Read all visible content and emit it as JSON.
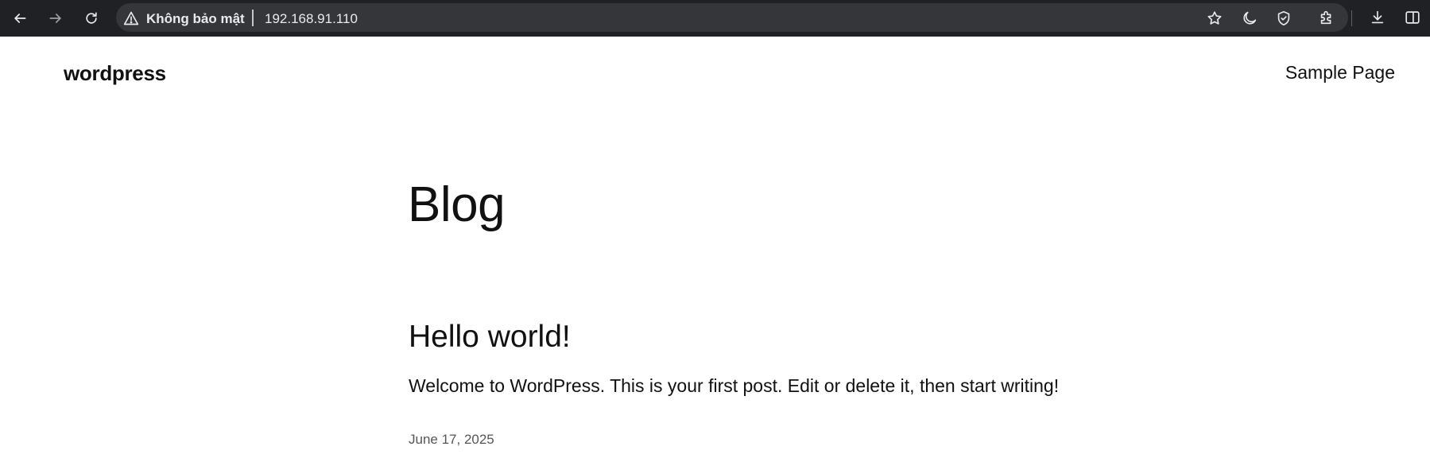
{
  "browser": {
    "security_label": "Không bảo mật",
    "url": "192.168.91.110",
    "icons": {
      "back": "back-arrow-icon",
      "forward": "forward-arrow-icon",
      "reload": "reload-icon",
      "warning": "warning-triangle-icon",
      "bookmark": "star-icon",
      "dark_mode": "moon-icon",
      "shield": "shield-icon",
      "extensions": "puzzle-icon",
      "downloads": "download-icon",
      "side_panel": "side-panel-icon"
    },
    "colors": {
      "toolbar_bg": "#202124",
      "omnibox_bg": "#35363a",
      "text": "#e8eaed"
    }
  },
  "site": {
    "title": "wordpress",
    "nav": [
      {
        "label": "Sample Page"
      }
    ]
  },
  "main": {
    "heading": "Blog",
    "posts": [
      {
        "title": "Hello world!",
        "excerpt": "Welcome to WordPress. This is your first post. Edit or delete it, then start writing!",
        "date": "June 17, 2025"
      }
    ]
  }
}
